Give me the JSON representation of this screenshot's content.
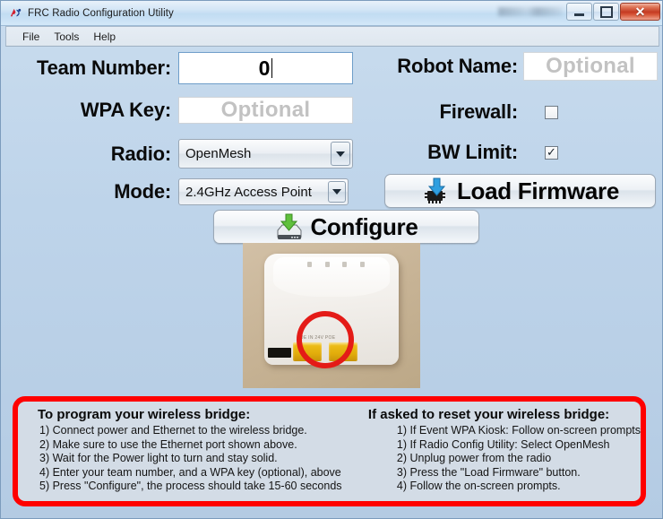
{
  "window": {
    "title": "FRC Radio Configuration Utility",
    "app_icon": "frc-logo-icon",
    "buttons": {
      "minimize": "minimize-icon",
      "maximize": "maximize-icon",
      "close": "✕"
    }
  },
  "menubar": {
    "items": [
      "File",
      "Tools",
      "Help"
    ]
  },
  "form": {
    "team_number": {
      "label": "Team Number:",
      "value": "0",
      "placeholder": ""
    },
    "wpa_key": {
      "label": "WPA Key:",
      "value": "",
      "placeholder": "Optional"
    },
    "radio": {
      "label": "Radio:",
      "value": "OpenMesh",
      "options": [
        "OpenMesh"
      ]
    },
    "mode": {
      "label": "Mode:",
      "value": "2.4GHz Access Point",
      "options": [
        "2.4GHz Access Point"
      ]
    },
    "robot_name": {
      "label": "Robot Name:",
      "value": "",
      "placeholder": "Optional"
    },
    "firewall": {
      "label": "Firewall:",
      "checked": false,
      "mark": ""
    },
    "bw_limit": {
      "label": "BW Limit:",
      "checked": true,
      "mark": "✓"
    }
  },
  "actions": {
    "load_firmware": {
      "label": "Load Firmware",
      "icon": "chip-download-icon"
    },
    "configure": {
      "label": "Configure",
      "icon": "harddrive-download-icon"
    }
  },
  "photo": {
    "alt": "wireless-bridge-photo",
    "port_label": "POE IN          24V POE",
    "highlight": "red-circle-highlight"
  },
  "instructions": {
    "accent_color": "#ff0000",
    "left": {
      "heading": "To program your wireless bridge:",
      "lines": [
        "1) Connect power and Ethernet to the wireless bridge.",
        "2) Make sure to use the Ethernet port shown above.",
        "3) Wait for the Power light to turn and stay solid.",
        "4) Enter your team number, and a WPA key (optional), above",
        "5) Press \"Configure\", the process should take 15-60 seconds"
      ]
    },
    "right": {
      "heading": "If asked to reset your wireless bridge:",
      "lines": [
        "1) If Event WPA Kiosk: Follow on-screen prompts",
        "1) If Radio Config Utility: Select OpenMesh",
        "2) Unplug power from the radio",
        "3) Press the \"Load Firmware\" button.",
        "4) Follow the on-screen prompts."
      ]
    }
  }
}
